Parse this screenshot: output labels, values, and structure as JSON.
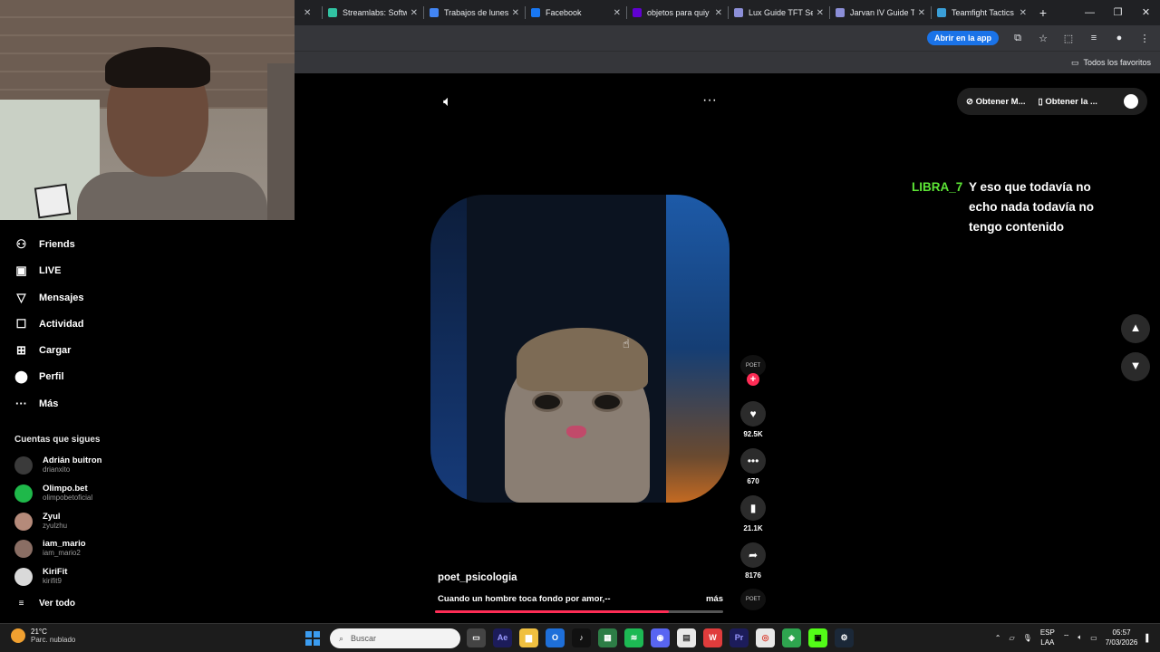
{
  "browser": {
    "tabs": [
      {
        "label": "Streamlabs: Softw",
        "color": "#31c3a2"
      },
      {
        "label": "Trabajos de lunes",
        "color": "#4285f4"
      },
      {
        "label": "Facebook",
        "color": "#1877f2"
      },
      {
        "label": "objetos para quiy",
        "color": "#6001d2"
      },
      {
        "label": "Lux Guide TFT Se",
        "color": "#8c8fd8"
      },
      {
        "label": "Jarvan IV Guide T",
        "color": "#8c8fd8"
      },
      {
        "label": "Teamfight Tactics",
        "color": "#3a9fd8"
      }
    ],
    "open_in_app": "Abrir en la app",
    "all_bookmarks": "Todos los favoritos"
  },
  "nav": {
    "items": [
      {
        "label": "Friends",
        "icon": "friends-icon"
      },
      {
        "label": "LIVE",
        "icon": "live-icon"
      },
      {
        "label": "Mensajes",
        "icon": "messages-icon"
      },
      {
        "label": "Actividad",
        "icon": "activity-icon"
      },
      {
        "label": "Cargar",
        "icon": "upload-icon"
      },
      {
        "label": "Perfil",
        "icon": "profile-icon"
      },
      {
        "label": "Más",
        "icon": "more-icon"
      }
    ],
    "following_title": "Cuentas que sigues",
    "following": [
      {
        "name": "Adrián buitron",
        "user": "drianxito",
        "color": "#3a3a3a"
      },
      {
        "name": "Olimpo.bet",
        "user": "olimpobetoficial",
        "color": "#1fb84a"
      },
      {
        "name": "Zyul",
        "user": "zyulzhu",
        "color": "#b58a7a"
      },
      {
        "name": "iam_mario",
        "user": "iam_mario2",
        "color": "#8a6e64"
      },
      {
        "name": "KiriFit",
        "user": "kirifit9",
        "color": "#d9d9d9"
      }
    ],
    "see_all": "Ver todo"
  },
  "header": {
    "get_coins": "Obtener M...",
    "get_app": "Obtener la ..."
  },
  "chat": {
    "user": "LIBRA_7",
    "message": "Y eso que todavía no echo nada todavía no tengo contenido"
  },
  "video": {
    "author": "poet_psicologia",
    "caption": "Cuando un hombre toca fondo por amor,--",
    "more": "más",
    "creator_tag": "POET",
    "likes": "92.5K",
    "comments": "670",
    "saves": "21.1K",
    "shares": "8176",
    "progress": 0.81
  },
  "taskbar": {
    "temp": "21°C",
    "weather": "Parc. nublado",
    "search_placeholder": "Buscar",
    "lang1": "ESP",
    "lang2": "LAA",
    "time": "05:57",
    "date": "7/03/2026"
  }
}
